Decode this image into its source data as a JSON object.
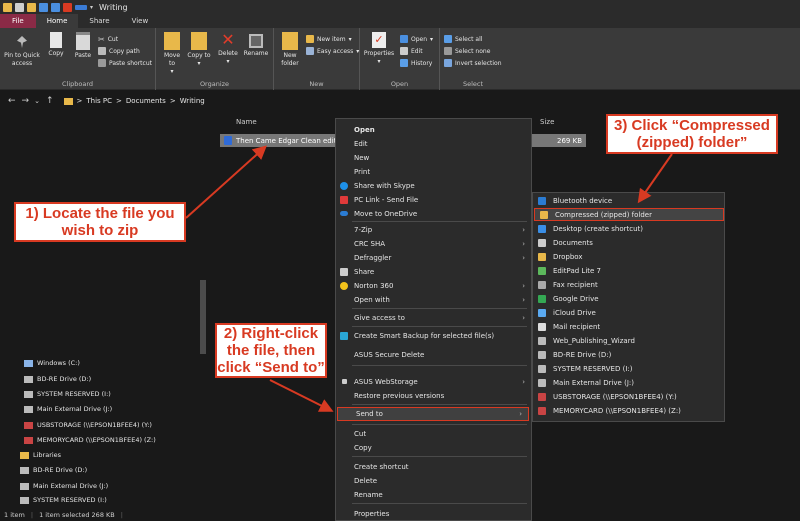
{
  "window": {
    "title": "Writing"
  },
  "tabs": [
    {
      "label": "File"
    },
    {
      "label": "Home"
    },
    {
      "label": "Share"
    },
    {
      "label": "View"
    }
  ],
  "ribbon": {
    "clipboard": {
      "label": "Clipboard",
      "pin": "Pin to Quick access",
      "copy": "Copy",
      "paste": "Paste",
      "cut": "Cut",
      "copy_path": "Copy path",
      "paste_shortcut": "Paste shortcut"
    },
    "organize": {
      "label": "Organize",
      "move_to": "Move to",
      "copy_to": "Copy to",
      "delete": "Delete",
      "rename": "Rename"
    },
    "new": {
      "label": "New",
      "new_folder": "New folder",
      "new_item": "New item",
      "easy_access": "Easy access"
    },
    "open": {
      "label": "Open",
      "properties": "Properties",
      "open": "Open",
      "edit": "Edit",
      "history": "History"
    },
    "select": {
      "label": "Select",
      "select_all": "Select all",
      "select_none": "Select none",
      "invert": "Invert selection"
    }
  },
  "address": {
    "crumbs": [
      "This PC",
      "Documents",
      "Writing"
    ],
    "sep": ">"
  },
  "columns": {
    "name": "Name",
    "size": "Size"
  },
  "file": {
    "name": "Then Came Edgar Clean edit",
    "size": "269 KB"
  },
  "navpane": {
    "items": [
      "Windows (C:)",
      "BD-RE Drive (D:)",
      "SYSTEM RESERVED (I:)",
      "Main External Drive (J:)",
      "USBSTORAGE (\\\\EPSON1BFEE4) (Y:)",
      "MEMORYCARD (\\\\EPSON1BFEE4) (Z:)",
      "Libraries",
      "BD-RE Drive (D:)",
      "Main External Drive (J:)",
      "SYSTEM RESERVED (I:)"
    ]
  },
  "status": {
    "items": "1 item",
    "selected": "1 item selected  268 KB"
  },
  "context_menu": {
    "items": [
      "Open",
      "Edit",
      "New",
      "Print",
      "Share with Skype",
      "PC Link - Send File",
      "Move to OneDrive",
      "7-Zip",
      "CRC SHA",
      "Defraggler",
      "Share",
      "Norton 360",
      "Open with",
      "Give access to",
      "Create Smart Backup for selected file(s)",
      "ASUS Secure Delete",
      "ASUS WebStorage",
      "Restore previous versions",
      "Send to",
      "Cut",
      "Copy",
      "Create shortcut",
      "Delete",
      "Rename",
      "Properties"
    ]
  },
  "send_to": {
    "items": [
      "Bluetooth device",
      "Compressed (zipped) folder",
      "Desktop (create shortcut)",
      "Documents",
      "Dropbox",
      "EditPad Lite 7",
      "Fax recipient",
      "Google Drive",
      "iCloud Drive",
      "Mail recipient",
      "Web_Publishing_Wizard",
      "BD-RE Drive (D:)",
      "SYSTEM RESERVED (I:)",
      "Main External Drive (J:)",
      "USBSTORAGE (\\\\EPSON1BFEE4) (Y:)",
      "MEMORYCARD (\\\\EPSON1BFEE4) (Z:)"
    ]
  },
  "callouts": {
    "step1": "1) Locate the file you wish to zip",
    "step2": "2) Right-click the file, then click “Send to”",
    "step3": "3) Click “Compressed (zipped) folder”"
  },
  "colors": {
    "accent": "#d83a22",
    "file_tab": "#8a2a46",
    "folder": "#e8b84a"
  }
}
